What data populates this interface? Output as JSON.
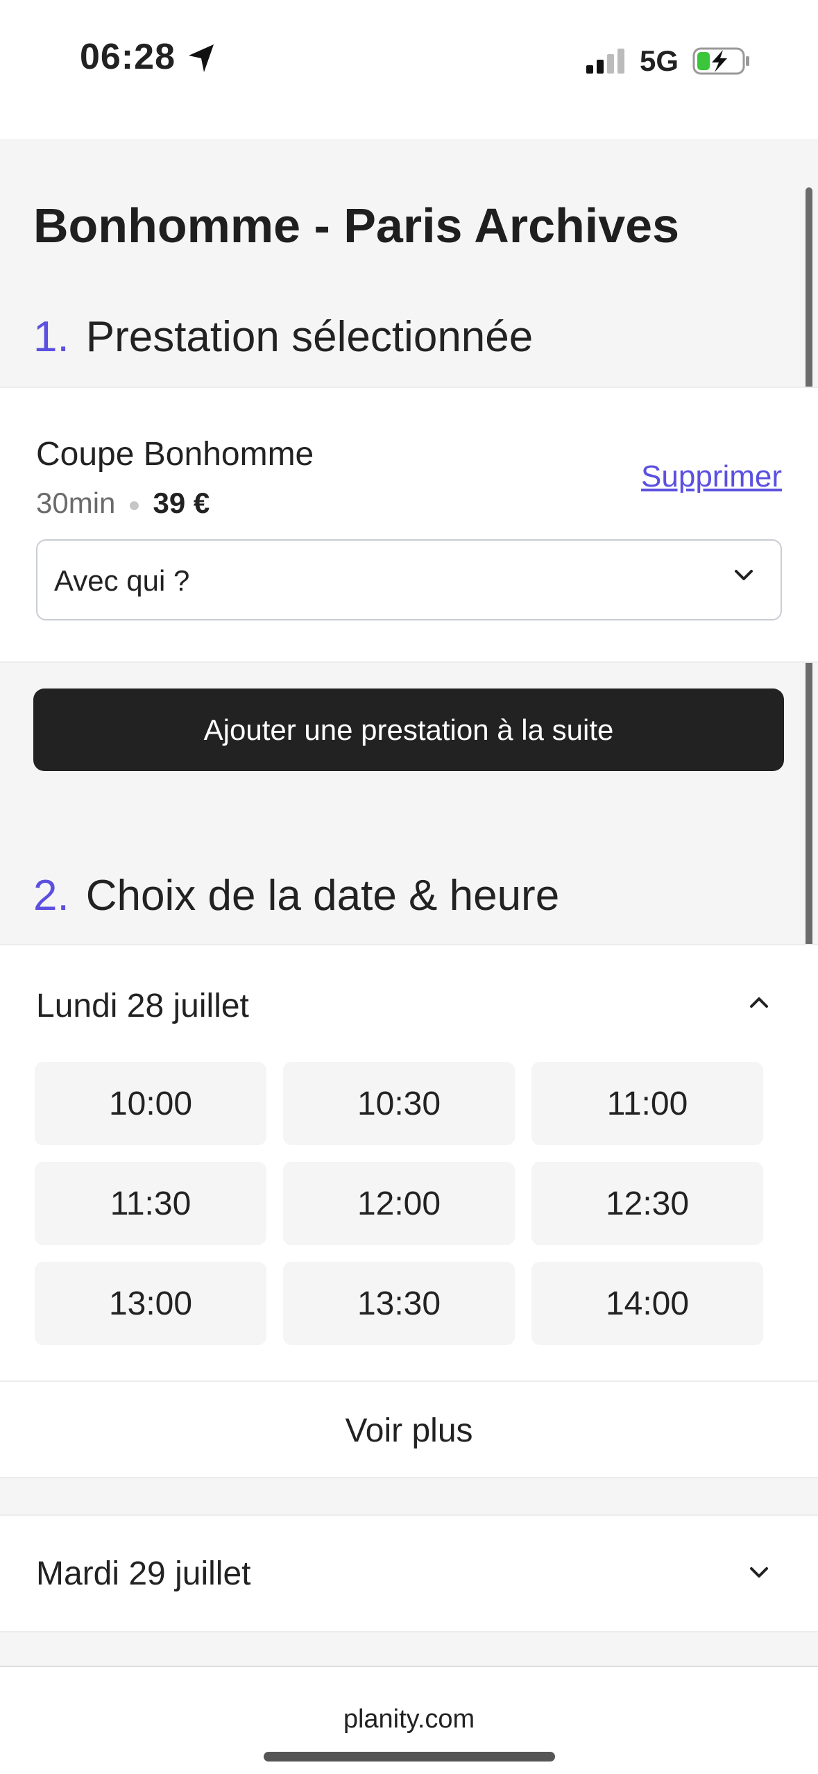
{
  "status_bar": {
    "time": "06:28",
    "network": "5G",
    "icons": [
      "location-arrow-icon",
      "signal-icon",
      "battery-charging-icon"
    ]
  },
  "salon": {
    "title": "Bonhomme - Paris Archives"
  },
  "section1": {
    "number": "1.",
    "title": "Prestation sélectionnée"
  },
  "service": {
    "name": "Coupe Bonhomme",
    "duration": "30min",
    "price": "39 €",
    "delete_label": "Supprimer",
    "staff_select_value": "Avec qui ?"
  },
  "add_button_label": "Ajouter une prestation à la suite",
  "section2": {
    "number": "2.",
    "title": "Choix de la date & heure"
  },
  "day1": {
    "label": "Lundi 28 juillet",
    "slots": [
      "10:00",
      "10:30",
      "11:00",
      "11:30",
      "12:00",
      "12:30",
      "13:00",
      "13:30",
      "14:00"
    ],
    "see_more": "Voir plus"
  },
  "day2": {
    "label": "Mardi 29 juillet"
  },
  "browser": {
    "url": "planity.com"
  },
  "colors": {
    "accent": "#5b50e0",
    "button": "#222222",
    "background": "#f5f5f5"
  }
}
